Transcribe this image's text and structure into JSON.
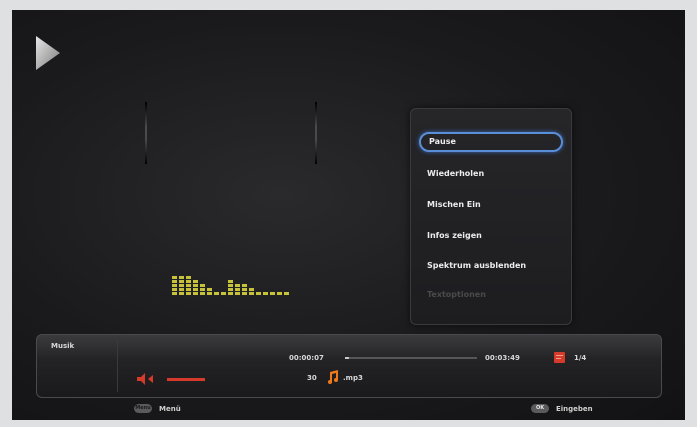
{
  "status": {
    "playback_icon": "play-icon"
  },
  "context_menu": {
    "items": [
      {
        "label": "Pause",
        "selected": true,
        "disabled": false
      },
      {
        "label": "Wiederholen",
        "selected": false,
        "disabled": false
      },
      {
        "label": "Mischen Ein",
        "selected": false,
        "disabled": false
      },
      {
        "label": "Infos zeigen",
        "selected": false,
        "disabled": false
      },
      {
        "label": "Spektrum ausblenden",
        "selected": false,
        "disabled": false
      },
      {
        "label": "Textoptionen",
        "selected": false,
        "disabled": true
      }
    ]
  },
  "player_bar": {
    "source_label": "Musik",
    "elapsed_time": "00:00:07",
    "total_time": "00:03:49",
    "progress_fraction": 0.03,
    "track_position": "1/4",
    "volume_value": "30",
    "file_extension": ".mp3",
    "volume_icon": "speaker-icon",
    "file_icon": "music-note-icon",
    "playlist_icon": "playlist-icon",
    "accent_color": "#d63a2a"
  },
  "footer": {
    "menu_button_label": "Menu",
    "menu_label": "Menü",
    "ok_button_label": "OK",
    "ok_label": "Eingeben"
  },
  "spectrum": {
    "color": "#c6c23a",
    "levels": [
      5,
      5,
      5,
      4,
      3,
      2,
      1,
      1,
      4,
      3,
      3,
      2,
      1,
      1,
      1,
      1,
      1
    ]
  }
}
